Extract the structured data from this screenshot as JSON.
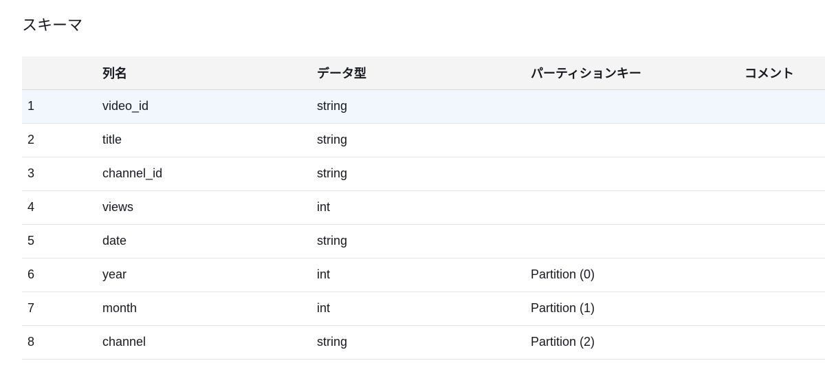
{
  "section": {
    "title": "スキーマ"
  },
  "table": {
    "headers": {
      "index": "",
      "name": "列名",
      "type": "データ型",
      "partition": "パーティションキー",
      "comment": "コメント"
    },
    "rows": [
      {
        "index": "1",
        "name": "video_id",
        "type": "string",
        "partition": "",
        "comment": ""
      },
      {
        "index": "2",
        "name": "title",
        "type": "string",
        "partition": "",
        "comment": ""
      },
      {
        "index": "3",
        "name": "channel_id",
        "type": "string",
        "partition": "",
        "comment": ""
      },
      {
        "index": "4",
        "name": "views",
        "type": "int",
        "partition": "",
        "comment": ""
      },
      {
        "index": "5",
        "name": "date",
        "type": "string",
        "partition": "",
        "comment": ""
      },
      {
        "index": "6",
        "name": "year",
        "type": "int",
        "partition": "Partition (0)",
        "comment": ""
      },
      {
        "index": "7",
        "name": "month",
        "type": "int",
        "partition": "Partition (1)",
        "comment": ""
      },
      {
        "index": "8",
        "name": "channel",
        "type": "string",
        "partition": "Partition (2)",
        "comment": ""
      }
    ]
  },
  "colors": {
    "header_background": "#f4f4f4",
    "highlight_row": "#f1f7fc",
    "text": "#16191f",
    "divider": "#e1e4e8"
  }
}
